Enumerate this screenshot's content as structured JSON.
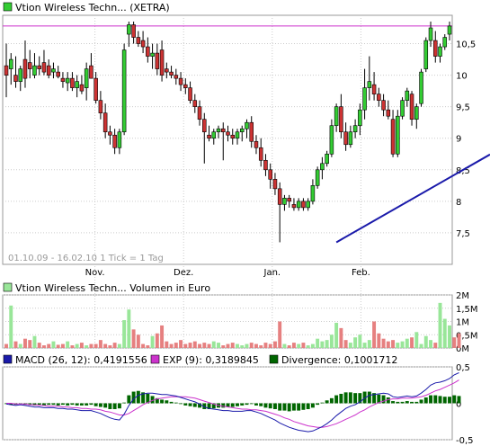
{
  "price_panel": {
    "legend_label": "Vtion Wireless Techn... (XETRA)",
    "date_range_note": "01.10.09 - 16.02.10   1 Tick = 1 Tag",
    "colors": {
      "up": "#33cc33",
      "down": "#cc3333",
      "trend": "#1a1aaa",
      "resistance": "#cc33cc",
      "grid": "#cccccc"
    }
  },
  "volume_panel": {
    "legend_label": "Vtion Wireless Techn... Volumen in Euro",
    "colors": {
      "up": "#99e699",
      "down": "#e68080"
    }
  },
  "macd_panel": {
    "legend_macd": "MACD (26, 12): 0,4191556",
    "legend_exp": "EXP (9): 0,3189845",
    "legend_div": "Divergence: 0,1001712",
    "colors": {
      "macd": "#1a1aaa",
      "exp": "#cc33cc",
      "div": "#006600"
    }
  },
  "chart_data": [
    {
      "type": "candlestick",
      "title": "Vtion Wireless Techn... (XETRA)",
      "x_tick_labels": [
        "Nov.",
        "Dez.",
        "Jan.",
        "Feb."
      ],
      "y_tick_labels": [
        "10,5",
        "10",
        "9,5",
        "9",
        "8,5",
        "8",
        "7,5"
      ],
      "y_ticks": [
        10.5,
        10,
        9.5,
        9,
        8.5,
        8,
        7.5
      ],
      "ylim": [
        7.0,
        10.95
      ],
      "resistance_level": 10.78,
      "trendline": [
        {
          "i": 70,
          "v": 7.35
        },
        {
          "i": 132,
          "v": 10.0
        }
      ],
      "candles": [
        {
          "o": 10.15,
          "h": 10.5,
          "l": 9.65,
          "c": 10.0
        },
        {
          "o": 10.1,
          "h": 10.35,
          "l": 9.85,
          "c": 10.25
        },
        {
          "o": 10.0,
          "h": 10.3,
          "l": 9.8,
          "c": 9.9
        },
        {
          "o": 9.9,
          "h": 10.15,
          "l": 9.75,
          "c": 10.1
        },
        {
          "o": 10.25,
          "h": 10.55,
          "l": 9.8,
          "c": 9.95
        },
        {
          "o": 10.2,
          "h": 10.4,
          "l": 9.95,
          "c": 10.1
        },
        {
          "o": 10.0,
          "h": 10.35,
          "l": 9.95,
          "c": 10.15
        },
        {
          "o": 10.15,
          "h": 10.3,
          "l": 10.0,
          "c": 10.1
        },
        {
          "o": 10.2,
          "h": 10.4,
          "l": 10.0,
          "c": 10.05
        },
        {
          "o": 10.15,
          "h": 10.25,
          "l": 9.95,
          "c": 10.0
        },
        {
          "o": 10.05,
          "h": 10.2,
          "l": 9.95,
          "c": 10.1
        },
        {
          "o": 10.05,
          "h": 10.15,
          "l": 9.95,
          "c": 9.98
        },
        {
          "o": 9.95,
          "h": 10.05,
          "l": 9.8,
          "c": 9.9
        },
        {
          "o": 9.88,
          "h": 10.05,
          "l": 9.75,
          "c": 9.95
        },
        {
          "o": 9.95,
          "h": 10.05,
          "l": 9.75,
          "c": 9.8
        },
        {
          "o": 9.8,
          "h": 10.0,
          "l": 9.65,
          "c": 9.9
        },
        {
          "o": 9.85,
          "h": 10.0,
          "l": 9.7,
          "c": 9.75
        },
        {
          "o": 9.8,
          "h": 10.2,
          "l": 9.6,
          "c": 10.1
        },
        {
          "o": 10.15,
          "h": 10.35,
          "l": 9.95,
          "c": 9.95
        },
        {
          "o": 9.95,
          "h": 10.05,
          "l": 9.55,
          "c": 9.6
        },
        {
          "o": 9.6,
          "h": 9.75,
          "l": 9.3,
          "c": 9.4
        },
        {
          "o": 9.4,
          "h": 9.55,
          "l": 9.0,
          "c": 9.1
        },
        {
          "o": 9.1,
          "h": 9.2,
          "l": 8.9,
          "c": 9.05
        },
        {
          "o": 9.05,
          "h": 9.15,
          "l": 8.75,
          "c": 8.85
        },
        {
          "o": 8.85,
          "h": 9.15,
          "l": 8.75,
          "c": 9.1
        },
        {
          "o": 9.1,
          "h": 10.5,
          "l": 9.05,
          "c": 10.4
        },
        {
          "o": 10.65,
          "h": 10.85,
          "l": 10.45,
          "c": 10.8
        },
        {
          "o": 10.8,
          "h": 10.85,
          "l": 10.5,
          "c": 10.6
        },
        {
          "o": 10.6,
          "h": 10.7,
          "l": 10.45,
          "c": 10.5
        },
        {
          "o": 10.55,
          "h": 10.7,
          "l": 10.35,
          "c": 10.45
        },
        {
          "o": 10.45,
          "h": 10.6,
          "l": 10.2,
          "c": 10.3
        },
        {
          "o": 10.3,
          "h": 10.5,
          "l": 10.1,
          "c": 10.35
        },
        {
          "o": 10.35,
          "h": 10.5,
          "l": 10.0,
          "c": 10.1
        },
        {
          "o": 10.4,
          "h": 10.55,
          "l": 9.9,
          "c": 10.0
        },
        {
          "o": 10.1,
          "h": 10.2,
          "l": 9.95,
          "c": 10.05
        },
        {
          "o": 10.05,
          "h": 10.15,
          "l": 9.95,
          "c": 10.0
        },
        {
          "o": 10.0,
          "h": 10.1,
          "l": 9.85,
          "c": 9.95
        },
        {
          "o": 9.95,
          "h": 10.05,
          "l": 9.75,
          "c": 9.85
        },
        {
          "o": 9.85,
          "h": 9.95,
          "l": 9.7,
          "c": 9.8
        },
        {
          "o": 9.8,
          "h": 9.9,
          "l": 9.55,
          "c": 9.6
        },
        {
          "o": 9.6,
          "h": 9.7,
          "l": 9.4,
          "c": 9.5
        },
        {
          "o": 9.5,
          "h": 9.6,
          "l": 9.2,
          "c": 9.3
        },
        {
          "o": 9.3,
          "h": 9.4,
          "l": 8.6,
          "c": 9.1
        },
        {
          "o": 9.05,
          "h": 9.2,
          "l": 8.95,
          "c": 9.0
        },
        {
          "o": 9.0,
          "h": 9.15,
          "l": 8.9,
          "c": 9.1
        },
        {
          "o": 9.1,
          "h": 9.2,
          "l": 9.0,
          "c": 9.15
        },
        {
          "o": 9.15,
          "h": 9.25,
          "l": 8.65,
          "c": 9.1
        },
        {
          "o": 9.1,
          "h": 9.2,
          "l": 8.95,
          "c": 9.05
        },
        {
          "o": 9.05,
          "h": 9.15,
          "l": 8.9,
          "c": 9.0
        },
        {
          "o": 9.0,
          "h": 9.15,
          "l": 8.9,
          "c": 9.1
        },
        {
          "o": 9.1,
          "h": 9.2,
          "l": 8.95,
          "c": 9.15
        },
        {
          "o": 9.15,
          "h": 9.3,
          "l": 9.0,
          "c": 9.25
        },
        {
          "o": 9.25,
          "h": 9.35,
          "l": 8.85,
          "c": 8.95
        },
        {
          "o": 8.95,
          "h": 9.05,
          "l": 8.75,
          "c": 8.85
        },
        {
          "o": 8.85,
          "h": 9.0,
          "l": 8.55,
          "c": 8.65
        },
        {
          "o": 8.65,
          "h": 8.75,
          "l": 8.4,
          "c": 8.5
        },
        {
          "o": 8.5,
          "h": 8.6,
          "l": 8.2,
          "c": 8.35
        },
        {
          "o": 8.35,
          "h": 8.45,
          "l": 8.1,
          "c": 8.2
        },
        {
          "o": 8.2,
          "h": 8.3,
          "l": 7.35,
          "c": 7.95
        },
        {
          "o": 7.95,
          "h": 8.1,
          "l": 7.85,
          "c": 8.05
        },
        {
          "o": 8.05,
          "h": 8.1,
          "l": 7.9,
          "c": 8.0
        },
        {
          "o": 7.95,
          "h": 8.05,
          "l": 7.85,
          "c": 7.9
        },
        {
          "o": 7.9,
          "h": 8.05,
          "l": 7.85,
          "c": 8.0
        },
        {
          "o": 8.0,
          "h": 8.05,
          "l": 7.85,
          "c": 7.9
        },
        {
          "o": 7.9,
          "h": 8.05,
          "l": 7.85,
          "c": 8.0
        },
        {
          "o": 8.0,
          "h": 8.35,
          "l": 7.95,
          "c": 8.25
        },
        {
          "o": 8.25,
          "h": 8.55,
          "l": 8.2,
          "c": 8.5
        },
        {
          "o": 8.5,
          "h": 8.7,
          "l": 8.35,
          "c": 8.6
        },
        {
          "o": 8.6,
          "h": 8.8,
          "l": 8.55,
          "c": 8.75
        },
        {
          "o": 8.75,
          "h": 9.3,
          "l": 8.7,
          "c": 9.2
        },
        {
          "o": 9.2,
          "h": 9.55,
          "l": 9.1,
          "c": 9.5
        },
        {
          "o": 9.5,
          "h": 9.7,
          "l": 9.0,
          "c": 9.1
        },
        {
          "o": 9.1,
          "h": 9.25,
          "l": 8.8,
          "c": 8.9
        },
        {
          "o": 8.9,
          "h": 9.2,
          "l": 8.85,
          "c": 9.1
        },
        {
          "o": 9.1,
          "h": 9.3,
          "l": 9.0,
          "c": 9.2
        },
        {
          "o": 9.2,
          "h": 9.55,
          "l": 9.05,
          "c": 9.45
        },
        {
          "o": 9.45,
          "h": 10.1,
          "l": 9.3,
          "c": 9.8
        },
        {
          "o": 9.8,
          "h": 10.3,
          "l": 9.6,
          "c": 9.9
        },
        {
          "o": 9.85,
          "h": 10.05,
          "l": 9.6,
          "c": 9.7
        },
        {
          "o": 9.7,
          "h": 9.8,
          "l": 9.5,
          "c": 9.6
        },
        {
          "o": 9.6,
          "h": 9.7,
          "l": 9.35,
          "c": 9.45
        },
        {
          "o": 9.45,
          "h": 9.6,
          "l": 9.3,
          "c": 9.35
        },
        {
          "o": 9.3,
          "h": 9.45,
          "l": 8.7,
          "c": 8.75
        },
        {
          "o": 8.75,
          "h": 9.45,
          "l": 8.7,
          "c": 9.35
        },
        {
          "o": 9.35,
          "h": 9.65,
          "l": 9.3,
          "c": 9.6
        },
        {
          "o": 9.6,
          "h": 9.8,
          "l": 9.5,
          "c": 9.75
        },
        {
          "o": 9.7,
          "h": 9.75,
          "l": 9.2,
          "c": 9.3
        },
        {
          "o": 9.3,
          "h": 9.55,
          "l": 9.15,
          "c": 9.5
        },
        {
          "o": 9.55,
          "h": 10.1,
          "l": 9.5,
          "c": 10.05
        },
        {
          "o": 10.1,
          "h": 10.6,
          "l": 10.05,
          "c": 10.55
        },
        {
          "o": 10.55,
          "h": 10.85,
          "l": 10.45,
          "c": 10.75
        },
        {
          "o": 10.55,
          "h": 10.7,
          "l": 10.2,
          "c": 10.3
        },
        {
          "o": 10.3,
          "h": 10.5,
          "l": 10.2,
          "c": 10.45
        },
        {
          "o": 10.45,
          "h": 10.65,
          "l": 10.4,
          "c": 10.6
        },
        {
          "o": 10.65,
          "h": 10.85,
          "l": 10.55,
          "c": 10.78
        }
      ]
    },
    {
      "type": "bar",
      "title": "Vtion Wireless Techn... Volumen in Euro",
      "y_tick_labels": [
        "2M",
        "1,5M",
        "1M",
        "0,5M",
        "0M"
      ],
      "y_ticks": [
        2.0,
        1.5,
        1.0,
        0.5,
        0.0
      ],
      "ylim": [
        0,
        2.0
      ],
      "unit": "M EUR",
      "values": [
        0.15,
        1.6,
        0.25,
        0.15,
        0.35,
        0.3,
        0.45,
        0.2,
        0.1,
        0.15,
        0.25,
        0.12,
        0.15,
        0.25,
        0.1,
        0.15,
        0.2,
        0.1,
        0.15,
        0.15,
        0.3,
        0.15,
        0.1,
        0.2,
        0.15,
        1.05,
        1.45,
        0.7,
        0.5,
        0.15,
        0.1,
        0.45,
        0.55,
        0.85,
        0.25,
        0.15,
        0.2,
        0.3,
        0.15,
        0.2,
        0.25,
        0.15,
        0.2,
        0.15,
        0.25,
        0.2,
        0.1,
        0.15,
        0.2,
        0.15,
        0.1,
        0.15,
        0.2,
        0.15,
        0.1,
        0.2,
        0.15,
        0.25,
        1.0,
        0.15,
        0.1,
        0.2,
        0.15,
        0.2,
        0.1,
        0.15,
        0.35,
        0.25,
        0.3,
        0.5,
        0.95,
        0.75,
        0.3,
        0.2,
        0.4,
        0.5,
        0.2,
        0.3,
        1.0,
        0.55,
        0.35,
        0.25,
        0.3,
        0.2,
        0.25,
        0.35,
        0.4,
        0.6,
        0.15,
        0.45,
        0.3,
        0.2,
        1.7,
        1.1,
        0.85,
        0.4,
        0.55
      ]
    },
    {
      "type": "line",
      "title": "MACD (26, 12)",
      "y_tick_labels": [
        "0,5",
        "0",
        "-0,5"
      ],
      "y_ticks": [
        0.5,
        0.0,
        -0.5
      ],
      "ylim": [
        -0.5,
        0.5
      ],
      "series": [
        {
          "name": "MACD (26, 12)",
          "key": "macd"
        },
        {
          "name": "EXP (9)",
          "key": "exp"
        },
        {
          "name": "Divergence",
          "key": "div"
        }
      ],
      "macd": [
        -0.01,
        -0.02,
        -0.03,
        -0.02,
        -0.03,
        -0.04,
        -0.05,
        -0.05,
        -0.06,
        -0.06,
        -0.06,
        -0.07,
        -0.07,
        -0.08,
        -0.08,
        -0.09,
        -0.1,
        -0.1,
        -0.1,
        -0.12,
        -0.14,
        -0.17,
        -0.2,
        -0.22,
        -0.23,
        -0.15,
        -0.03,
        0.06,
        0.11,
        0.13,
        0.14,
        0.14,
        0.13,
        0.12,
        0.12,
        0.11,
        0.1,
        0.08,
        0.06,
        0.04,
        0.02,
        -0.01,
        -0.05,
        -0.07,
        -0.08,
        -0.09,
        -0.1,
        -0.1,
        -0.11,
        -0.11,
        -0.11,
        -0.1,
        -0.1,
        -0.12,
        -0.14,
        -0.17,
        -0.2,
        -0.23,
        -0.27,
        -0.3,
        -0.33,
        -0.35,
        -0.37,
        -0.38,
        -0.39,
        -0.38,
        -0.35,
        -0.32,
        -0.28,
        -0.23,
        -0.17,
        -0.12,
        -0.07,
        -0.04,
        -0.02,
        0.02,
        0.07,
        0.11,
        0.12,
        0.13,
        0.14,
        0.13,
        0.09,
        0.08,
        0.09,
        0.1,
        0.09,
        0.1,
        0.14,
        0.19,
        0.25,
        0.28,
        0.29,
        0.31,
        0.34,
        0.39,
        0.42
      ],
      "exp": [
        0.0,
        0.0,
        -0.01,
        -0.01,
        -0.01,
        -0.02,
        -0.02,
        -0.03,
        -0.03,
        -0.04,
        -0.04,
        -0.04,
        -0.05,
        -0.05,
        -0.06,
        -0.06,
        -0.07,
        -0.07,
        -0.08,
        -0.08,
        -0.09,
        -0.11,
        -0.12,
        -0.14,
        -0.16,
        -0.16,
        -0.14,
        -0.1,
        -0.06,
        -0.02,
        0.01,
        0.04,
        0.06,
        0.07,
        0.08,
        0.09,
        0.09,
        0.09,
        0.09,
        0.08,
        0.07,
        0.05,
        0.03,
        0.01,
        -0.01,
        -0.03,
        -0.04,
        -0.05,
        -0.06,
        -0.07,
        -0.08,
        -0.08,
        -0.09,
        -0.09,
        -0.1,
        -0.11,
        -0.13,
        -0.15,
        -0.17,
        -0.2,
        -0.22,
        -0.25,
        -0.27,
        -0.29,
        -0.31,
        -0.32,
        -0.33,
        -0.33,
        -0.32,
        -0.3,
        -0.28,
        -0.25,
        -0.22,
        -0.19,
        -0.16,
        -0.12,
        -0.09,
        -0.05,
        -0.02,
        0.01,
        0.03,
        0.05,
        0.06,
        0.06,
        0.07,
        0.07,
        0.07,
        0.08,
        0.09,
        0.11,
        0.14,
        0.17,
        0.19,
        0.22,
        0.25,
        0.28,
        0.32
      ],
      "div": [
        -0.01,
        -0.02,
        -0.02,
        -0.01,
        -0.02,
        -0.02,
        -0.03,
        -0.02,
        -0.03,
        -0.02,
        -0.02,
        -0.03,
        -0.02,
        -0.03,
        -0.02,
        -0.03,
        -0.03,
        -0.03,
        -0.02,
        -0.04,
        -0.05,
        -0.06,
        -0.08,
        -0.08,
        -0.07,
        0.01,
        0.11,
        0.16,
        0.17,
        0.15,
        0.13,
        0.1,
        0.07,
        0.05,
        0.04,
        0.02,
        0.01,
        -0.01,
        -0.03,
        -0.04,
        -0.05,
        -0.06,
        -0.08,
        -0.08,
        -0.07,
        -0.06,
        -0.06,
        -0.05,
        -0.05,
        -0.04,
        -0.03,
        -0.02,
        -0.01,
        -0.03,
        -0.04,
        -0.06,
        -0.07,
        -0.08,
        -0.1,
        -0.1,
        -0.11,
        -0.1,
        -0.1,
        -0.09,
        -0.08,
        -0.06,
        -0.02,
        0.01,
        0.04,
        0.07,
        0.11,
        0.13,
        0.15,
        0.15,
        0.14,
        0.14,
        0.16,
        0.16,
        0.14,
        0.12,
        0.11,
        0.08,
        0.03,
        0.02,
        0.02,
        0.03,
        0.02,
        0.02,
        0.05,
        0.08,
        0.11,
        0.11,
        0.1,
        0.09,
        0.09,
        0.11,
        0.1
      ]
    }
  ]
}
